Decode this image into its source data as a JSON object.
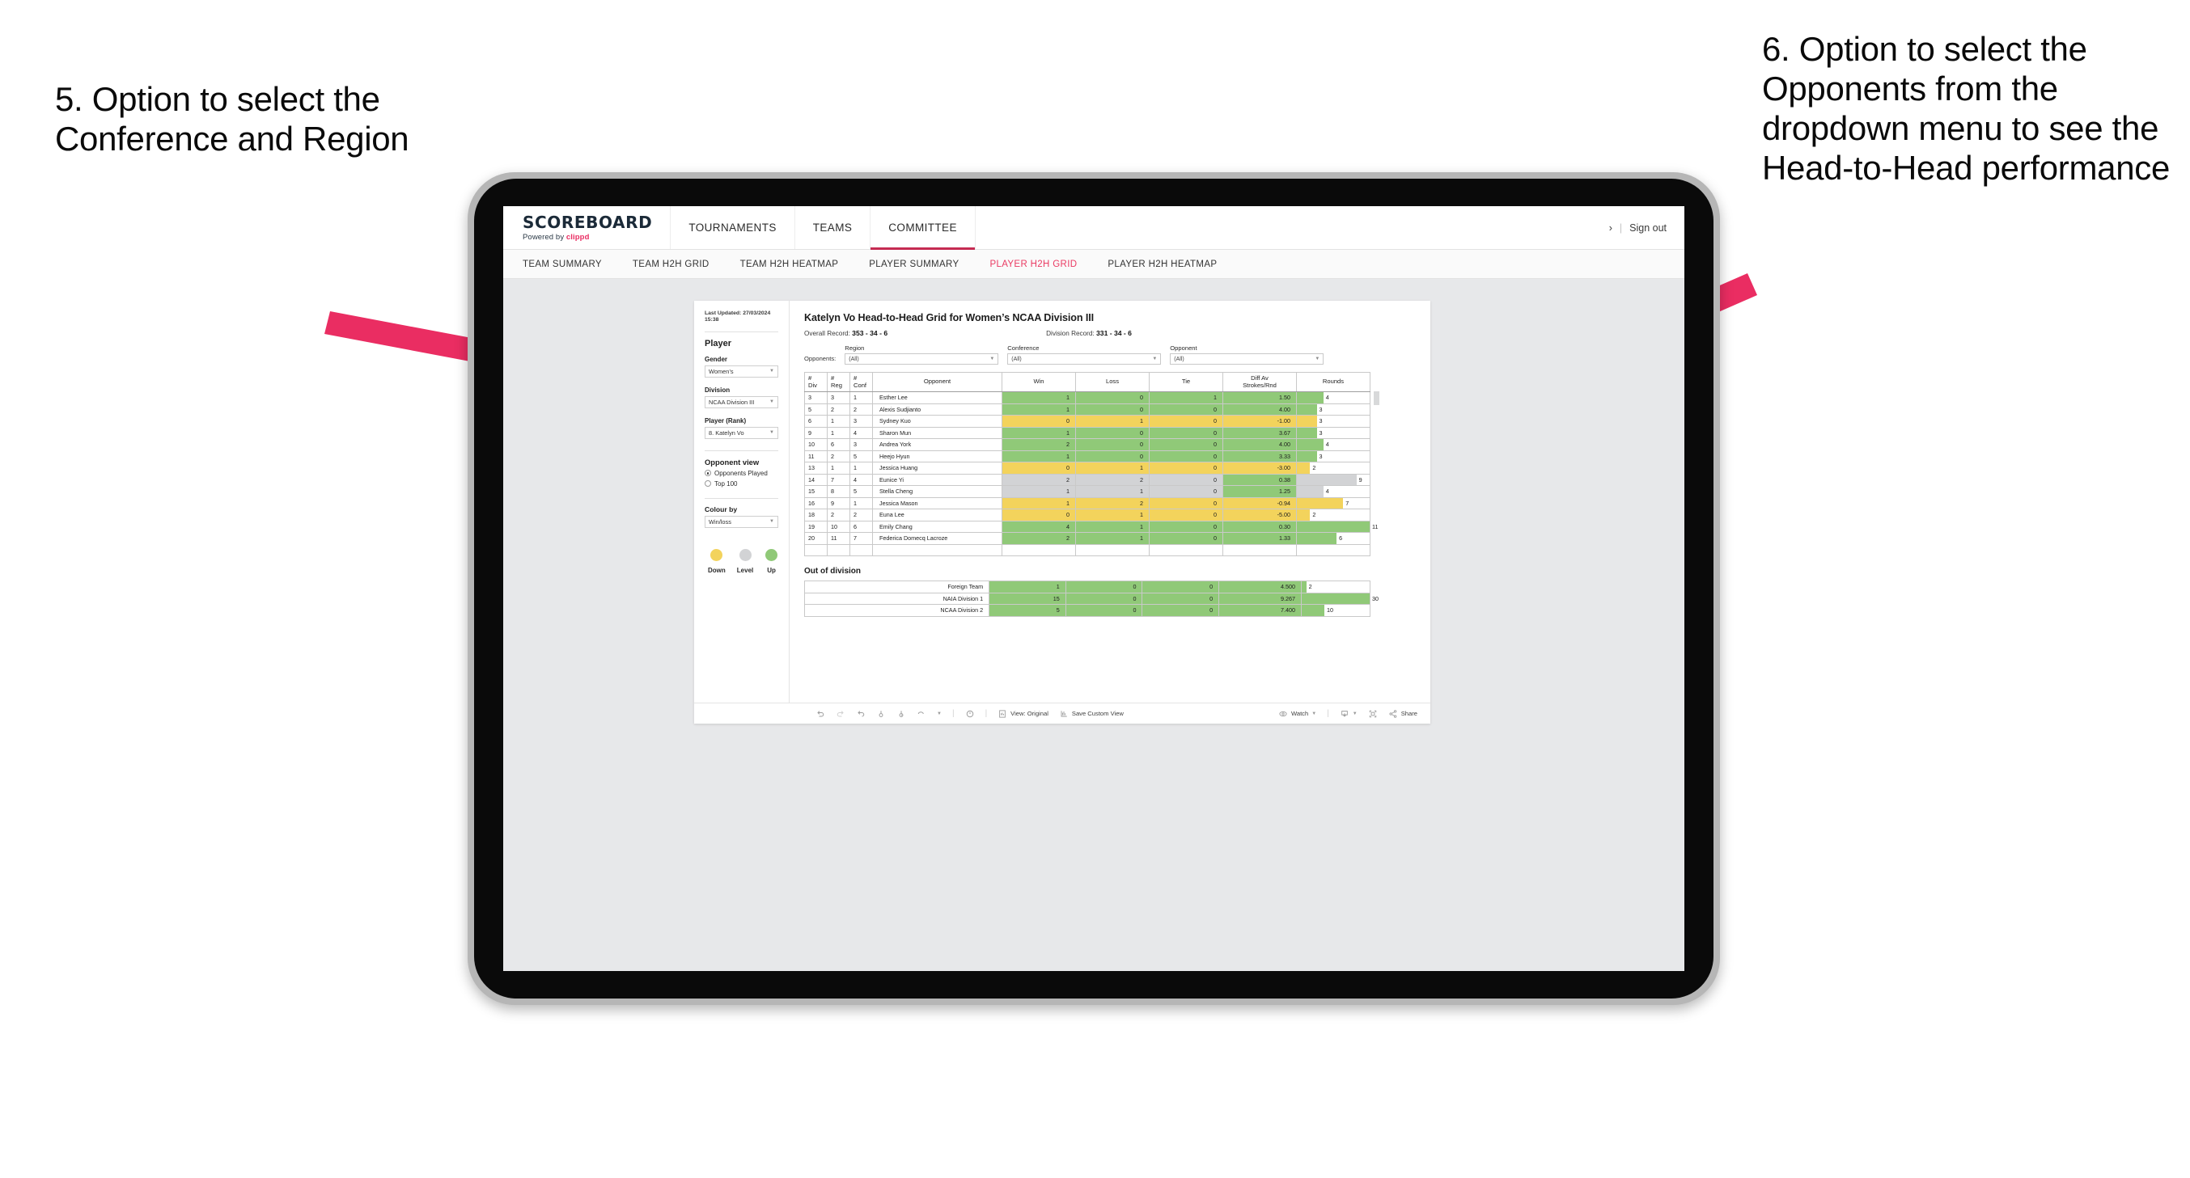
{
  "annotations": {
    "left": "5. Option to select the Conference and Region",
    "right": "6. Option to select the Opponents from the dropdown menu to see the Head-to-Head performance",
    "arrow_color": "#ea2d62"
  },
  "app": {
    "brand": {
      "name": "SCOREBOARD",
      "powered_prefix": "Powered by",
      "powered_by": "clippd"
    },
    "top_nav": [
      {
        "label": "TOURNAMENTS",
        "active": false
      },
      {
        "label": "TEAMS",
        "active": false
      },
      {
        "label": "COMMITTEE",
        "active": true
      }
    ],
    "header_right": {
      "chevron": "›",
      "separator": "|",
      "sign_out": "Sign out"
    },
    "sub_nav": [
      {
        "label": "TEAM SUMMARY",
        "active": false
      },
      {
        "label": "TEAM H2H GRID",
        "active": false
      },
      {
        "label": "TEAM H2H HEATMAP",
        "active": false
      },
      {
        "label": "PLAYER SUMMARY",
        "active": false
      },
      {
        "label": "PLAYER H2H GRID",
        "active": true
      },
      {
        "label": "PLAYER H2H HEATMAP",
        "active": false
      }
    ]
  },
  "sidebar": {
    "last_updated": "Last Updated: 27/03/2024 15:38",
    "player_heading": "Player",
    "gender": {
      "label": "Gender",
      "value": "Women’s"
    },
    "division": {
      "label": "Division",
      "value": "NCAA Division III"
    },
    "player_rank": {
      "label": "Player (Rank)",
      "value": "8. Katelyn Vo"
    },
    "opponent_view": {
      "heading": "Opponent view",
      "options": [
        {
          "label": "Opponents Played",
          "selected": true
        },
        {
          "label": "Top 100",
          "selected": false
        }
      ]
    },
    "colour_by": {
      "label": "Colour by",
      "value": "Win/loss"
    },
    "legend": [
      {
        "label": "Down",
        "color": "#f3d35c"
      },
      {
        "label": "Level",
        "color": "#d2d3d5"
      },
      {
        "label": "Up",
        "color": "#90c978"
      }
    ]
  },
  "main": {
    "title": "Katelyn Vo Head-to-Head Grid for Women’s NCAA Division III",
    "overall_record": {
      "label": "Overall Record:",
      "value": "353 - 34 - 6"
    },
    "division_record": {
      "label": "Division Record:",
      "value": "331 - 34 - 6"
    },
    "filters_lead": "Opponents:",
    "filters": [
      {
        "label": "Region",
        "value": "(All)"
      },
      {
        "label": "Conference",
        "value": "(All)"
      },
      {
        "label": "Opponent",
        "value": "(All)"
      }
    ],
    "table": {
      "headers": [
        "# Div",
        "# Reg",
        "# Conf",
        "Opponent",
        "Win",
        "Loss",
        "Tie",
        "Diff Av Strokes/Rnd",
        "Rounds"
      ],
      "header_lines": {
        "div": [
          "#",
          "Div"
        ],
        "reg": [
          "#",
          "Reg"
        ],
        "conf": [
          "#",
          "Conf"
        ],
        "opponent": "Opponent",
        "win": "Win",
        "loss": "Loss",
        "tie": "Tie",
        "diff": [
          "Diff Av",
          "Strokes/Rnd"
        ],
        "rounds": "Rounds"
      },
      "rows": [
        {
          "div": "3",
          "reg": "3",
          "conf": "1",
          "opponent": "Esther Lee",
          "win": "1",
          "loss": "0",
          "tie": "1",
          "diff": "1.50",
          "rounds": "4",
          "color": "#90c978"
        },
        {
          "div": "5",
          "reg": "2",
          "conf": "2",
          "opponent": "Alexis Sudjianto",
          "win": "1",
          "loss": "0",
          "tie": "0",
          "diff": "4.00",
          "rounds": "3",
          "color": "#90c978"
        },
        {
          "div": "6",
          "reg": "1",
          "conf": "3",
          "opponent": "Sydney Kuo",
          "win": "0",
          "loss": "1",
          "tie": "0",
          "diff": "-1.00",
          "rounds": "3",
          "color": "#f3d35c"
        },
        {
          "div": "9",
          "reg": "1",
          "conf": "4",
          "opponent": "Sharon Mun",
          "win": "1",
          "loss": "0",
          "tie": "0",
          "diff": "3.67",
          "rounds": "3",
          "color": "#90c978"
        },
        {
          "div": "10",
          "reg": "6",
          "conf": "3",
          "opponent": "Andrea York",
          "win": "2",
          "loss": "0",
          "tie": "0",
          "diff": "4.00",
          "rounds": "4",
          "color": "#90c978"
        },
        {
          "div": "11",
          "reg": "2",
          "conf": "5",
          "opponent": "Heejo Hyun",
          "win": "1",
          "loss": "0",
          "tie": "0",
          "diff": "3.33",
          "rounds": "3",
          "color": "#90c978"
        },
        {
          "div": "13",
          "reg": "1",
          "conf": "1",
          "opponent": "Jessica Huang",
          "win": "0",
          "loss": "1",
          "tie": "0",
          "diff": "-3.00",
          "rounds": "2",
          "color": "#f3d35c"
        },
        {
          "div": "14",
          "reg": "7",
          "conf": "4",
          "opponent": "Eunice Yi",
          "win": "2",
          "loss": "2",
          "tie": "0",
          "diff": "0.38",
          "rounds": "9",
          "color": "#d2d3d5",
          "diff_color": "#90c978"
        },
        {
          "div": "15",
          "reg": "8",
          "conf": "5",
          "opponent": "Stella Cheng",
          "win": "1",
          "loss": "1",
          "tie": "0",
          "diff": "1.25",
          "rounds": "4",
          "color": "#d2d3d5",
          "diff_color": "#90c978"
        },
        {
          "div": "16",
          "reg": "9",
          "conf": "1",
          "opponent": "Jessica Mason",
          "win": "1",
          "loss": "2",
          "tie": "0",
          "diff": "-0.94",
          "rounds": "7",
          "color": "#f3d35c"
        },
        {
          "div": "18",
          "reg": "2",
          "conf": "2",
          "opponent": "Euna Lee",
          "win": "0",
          "loss": "1",
          "tie": "0",
          "diff": "-5.00",
          "rounds": "2",
          "color": "#f3d35c"
        },
        {
          "div": "19",
          "reg": "10",
          "conf": "6",
          "opponent": "Emily Chang",
          "win": "4",
          "loss": "1",
          "tie": "0",
          "diff": "0.30",
          "rounds": "11",
          "color": "#90c978"
        },
        {
          "div": "20",
          "reg": "11",
          "conf": "7",
          "opponent": "Federica Domecq Lacroze",
          "win": "2",
          "loss": "1",
          "tie": "0",
          "diff": "1.33",
          "rounds": "6",
          "color": "#90c978"
        }
      ],
      "max_rounds": 11
    },
    "out_of_division": {
      "heading": "Out of division",
      "rows": [
        {
          "name": "Foreign Team",
          "win": "1",
          "loss": "0",
          "tie": "0",
          "diff": "4.500",
          "rounds": "2",
          "color": "#90c978"
        },
        {
          "name": "NAIA Division 1",
          "win": "15",
          "loss": "0",
          "tie": "0",
          "diff": "9.267",
          "rounds": "30",
          "color": "#90c978"
        },
        {
          "name": "NCAA Division 2",
          "win": "5",
          "loss": "0",
          "tie": "0",
          "diff": "7.400",
          "rounds": "10",
          "color": "#90c978"
        }
      ],
      "max_rounds": 30
    }
  },
  "toolbar": {
    "view_label": "View: Original",
    "save_label": "Save Custom View",
    "watch_label": "Watch",
    "share_label": "Share"
  }
}
